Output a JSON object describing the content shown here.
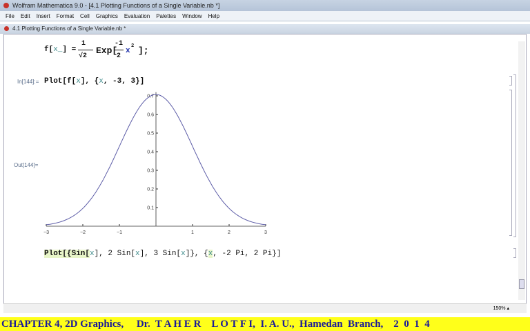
{
  "window": {
    "title": "Wolfram Mathematica 9.0 - [4.1 Plotting Functions of a Single Variable.nb *]"
  },
  "menu": [
    "File",
    "Edit",
    "Insert",
    "Format",
    "Cell",
    "Graphics",
    "Evaluation",
    "Palettes",
    "Window",
    "Help"
  ],
  "doc_tab": "4.1 Plotting Functions of a Single Variable.nb *",
  "cells": {
    "def": {
      "lhs": "f[",
      "arg": "x_",
      "rhs": "] =",
      "num": "1",
      "den": "√2",
      "exp": "Exp[",
      "fnum": "-1",
      "fden": "2",
      "x": "x",
      "pow": "2",
      "end": "];"
    },
    "in_label": "In[144]:=",
    "in_code_a": "Plot[f[",
    "in_code_x": "x",
    "in_code_b": "], {",
    "in_code_x2": "x",
    "in_code_c": ", -3, 3}]",
    "out_label": "Out[144]=",
    "next": {
      "a": "Plot[{Sin[",
      "x": "x",
      "b": "], 2 Sin[",
      "c": "], 3 Sin[",
      "d": "]}, {",
      "e": ", -2 Pi, 2 Pi}]"
    }
  },
  "zoom": "150%",
  "banner": "CHAPTER 4, 2D Graphics,     Dr.  T A H E R    L O T F I,  I. A. U.,  Hamedan  Branch,    2  0  1  4",
  "chart_data": {
    "type": "line",
    "function": "f(x)=Exp[-x^2/2]/Sqrt[2]",
    "xlim": [
      -3,
      3
    ],
    "ylim": [
      0,
      0.707
    ],
    "xticks": [
      "-3",
      "-2",
      "-1",
      "1",
      "2",
      "3"
    ],
    "yticks": [
      "0.1",
      "0.2",
      "0.3",
      "0.4",
      "0.5",
      "0.6",
      "0.7"
    ],
    "color": "#5e5ea8"
  }
}
